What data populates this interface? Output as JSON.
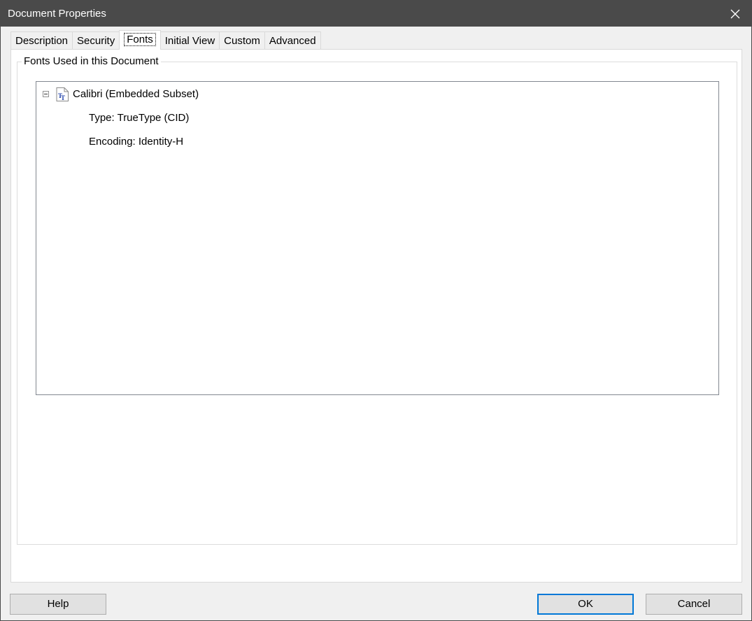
{
  "window": {
    "title": "Document Properties",
    "close_icon": "close-icon"
  },
  "tabs": [
    {
      "label": "Description",
      "active": false
    },
    {
      "label": "Security",
      "active": false
    },
    {
      "label": "Fonts",
      "active": true
    },
    {
      "label": "Initial View",
      "active": false
    },
    {
      "label": "Custom",
      "active": false
    },
    {
      "label": "Advanced",
      "active": false
    }
  ],
  "fonts_panel": {
    "group_label": "Fonts Used in this Document",
    "fonts": [
      {
        "name": "Calibri (Embedded Subset)",
        "icon": "truetype-font-icon",
        "expanded": true,
        "details": [
          "Type: TrueType (CID)",
          "Encoding: Identity-H"
        ]
      }
    ]
  },
  "buttons": {
    "help": "Help",
    "ok": "OK",
    "cancel": "Cancel"
  },
  "colors": {
    "titlebar": "#4a4a4a",
    "accent": "#0078d7",
    "icon_blue": "#1f3fa8"
  }
}
